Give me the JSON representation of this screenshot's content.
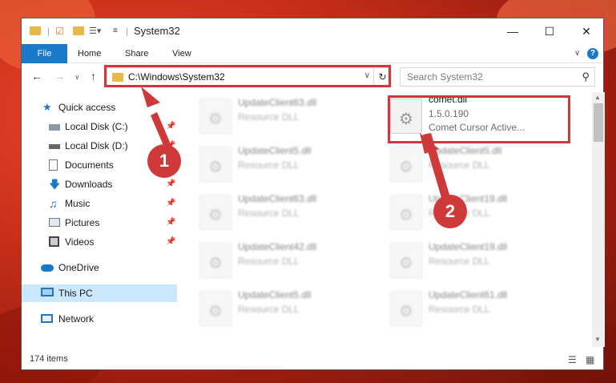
{
  "window": {
    "title": "System32",
    "quick_access_icons": [
      "folder-icon",
      "properties-icon",
      "new-folder-icon",
      "customize-toolbar-icon"
    ]
  },
  "ribbon": {
    "file_label": "File",
    "home_label": "Home",
    "share_label": "Share",
    "view_label": "View",
    "help_glyph": "?"
  },
  "address": {
    "path": "C:\\Windows\\System32",
    "search_placeholder": "Search System32"
  },
  "sidebar": {
    "items": [
      {
        "label": "Quick access",
        "icon": "star-icon"
      },
      {
        "label": "Local Disk (C:)",
        "icon": "drive-icon"
      },
      {
        "label": "Local Disk (D:)",
        "icon": "drive-icon"
      },
      {
        "label": "Documents",
        "icon": "documents-icon"
      },
      {
        "label": "Downloads",
        "icon": "download-icon"
      },
      {
        "label": "Music",
        "icon": "music-icon"
      },
      {
        "label": "Pictures",
        "icon": "pictures-icon"
      },
      {
        "label": "Videos",
        "icon": "videos-icon"
      },
      {
        "label": "OneDrive",
        "icon": "cloud-icon"
      },
      {
        "label": "This PC",
        "icon": "computer-icon"
      },
      {
        "label": "Network",
        "icon": "network-icon"
      }
    ]
  },
  "files": {
    "highlighted": {
      "name": "comet.dll",
      "version": "1.5.0.190",
      "description": "Comet Cursor Active..."
    },
    "blurred": [
      {
        "name": "UpdateClient63.dll",
        "desc": "Resource DLL"
      },
      {
        "name": "UpdateClient5.dll",
        "desc": "Resource DLL"
      },
      {
        "name": "UpdateClient5.dll",
        "desc": "Resource DLL"
      },
      {
        "name": "UpdateClient63.dll",
        "desc": "Resource DLL"
      },
      {
        "name": "UpdateClient19.dll",
        "desc": "Resource DLL"
      },
      {
        "name": "UpdateClient42.dll",
        "desc": "Resource DLL"
      },
      {
        "name": "UpdateClient19.dll",
        "desc": "Resource DLL"
      },
      {
        "name": "UpdateClient5.dll",
        "desc": "Resource DLL"
      },
      {
        "name": "UpdateClient61.dll",
        "desc": "Resource DLL"
      }
    ]
  },
  "status": {
    "count": "174 items"
  },
  "annotations": {
    "step1": "1",
    "step2": "2"
  },
  "colors": {
    "accent": "#1979ca",
    "highlight": "#d0393a",
    "selected": "#cce8ff"
  }
}
